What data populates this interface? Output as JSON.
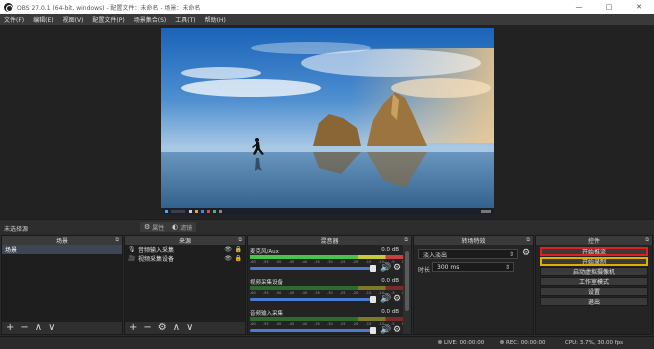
{
  "window": {
    "title": "OBS 27.0.1 (64-bit, windows) - 配置文件：未命名 - 场景：未命名",
    "minimize": "—",
    "maximize": "□",
    "close": "✕"
  },
  "menu": [
    "文件(F)",
    "编辑(E)",
    "视图(V)",
    "配置文件(P)",
    "场景集合(S)",
    "工具(T)",
    "帮助(H)"
  ],
  "source_bar": {
    "current_source": "未选择源",
    "properties": "属性",
    "filters": "滤镜"
  },
  "scenes": {
    "title": "场景",
    "items": [
      "场景"
    ]
  },
  "sources": {
    "title": "来源",
    "items": [
      {
        "label": "音频输入采集",
        "icon": "microphone-icon"
      },
      {
        "label": "视频采集设备",
        "icon": "camera-icon"
      }
    ]
  },
  "mixer": {
    "title": "混音器",
    "scale": [
      "-60",
      "-55",
      "-50",
      "-45",
      "-40",
      "-35",
      "-30",
      "-25",
      "-20",
      "-15",
      "-10",
      "-5",
      "0"
    ],
    "channels": [
      {
        "name": "麦克风/Aux",
        "db": "0.0 dB",
        "active": true
      },
      {
        "name": "视频采集设备",
        "db": "0.0 dB",
        "active": false
      },
      {
        "name": "音频输入采集",
        "db": "0.0 dB",
        "active": false
      }
    ]
  },
  "transitions": {
    "title": "转场特效",
    "selected": "淡入淡出",
    "duration_label": "时长",
    "duration": "300 ms"
  },
  "controls": {
    "title": "控件",
    "buttons": [
      "开始推流",
      "开始录制",
      "启动虚拟摄像机",
      "工作室模式",
      "设置",
      "退出"
    ]
  },
  "status": {
    "live": "LIVE: 00:00:00",
    "rec": "REC: 00:00:00",
    "cpu": "CPU: 3.7%, 30.00 fps"
  },
  "colors": {
    "highlight_start_stream": "#e02020",
    "highlight_start_record": "#e0b000"
  }
}
